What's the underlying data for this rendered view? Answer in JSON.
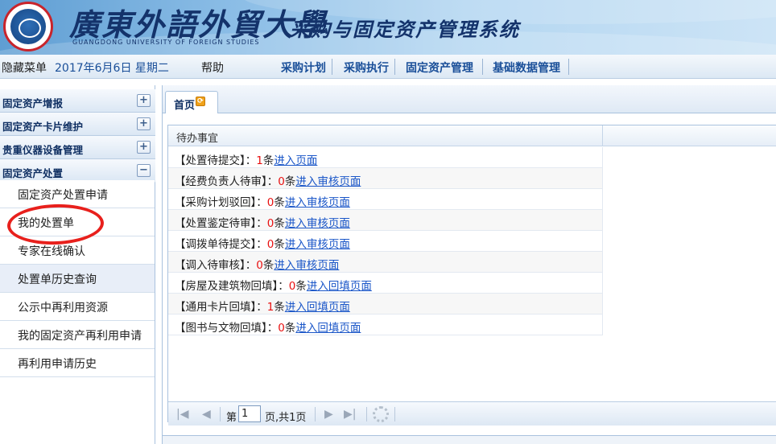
{
  "header": {
    "school_name": "廣東外語外貿大學",
    "school_name_en": "GUANGDONG UNIVERSITY OF FOREIGN STUDIES",
    "system_name": "采购与固定资产管理系统"
  },
  "menubar": {
    "hide_menu": "隐藏菜单",
    "date": "2017年6月6日 星期二",
    "help": "帮助",
    "nav": [
      "采购计划",
      "采购执行",
      "固定资产管理",
      "基础数据管理"
    ]
  },
  "sidebar": {
    "sections": [
      {
        "label": "固定资产增报",
        "toggle": "+"
      },
      {
        "label": "固定资产卡片维护",
        "toggle": "+"
      },
      {
        "label": "贵重仪器设备管理",
        "toggle": "+"
      },
      {
        "label": "固定资产处置",
        "toggle": "−"
      }
    ],
    "items": [
      "固定资产处置申请",
      "我的处置单",
      "专家在线确认",
      "处置单历史查询",
      "公示中再利用资源",
      "我的固定资产再利用申请",
      "再利用申请历史"
    ]
  },
  "tabs": [
    {
      "label": "首页"
    }
  ],
  "grid": {
    "header": "待办事宜",
    "rows": [
      {
        "prefix": "【处置待提交】：",
        "count": "1",
        "unit": "条",
        "link": "进入页面"
      },
      {
        "prefix": "【经费负责人待审】：",
        "count": "0",
        "unit": "条",
        "link": "进入审核页面"
      },
      {
        "prefix": "【采购计划驳回】：",
        "count": "0",
        "unit": "条",
        "link": "进入审核页面"
      },
      {
        "prefix": "【处置鉴定待审】：",
        "count": "0",
        "unit": "条",
        "link": "进入审核页面"
      },
      {
        "prefix": "【调拨单待提交】：",
        "count": "0",
        "unit": "条",
        "link": "进入审核页面"
      },
      {
        "prefix": "【调入待审核】：",
        "count": "0",
        "unit": "条",
        "link": "进入审核页面"
      },
      {
        "prefix": "【房屋及建筑物回填】：",
        "count": "0",
        "unit": "条",
        "link": "进入回填页面"
      },
      {
        "prefix": "【通用卡片回填】：",
        "count": "1",
        "unit": "条",
        "link": "进入回填页面"
      },
      {
        "prefix": "【图书与文物回填】：",
        "count": "0",
        "unit": "条",
        "link": "进入回填页面"
      }
    ]
  },
  "pager": {
    "page_prefix": "第",
    "page_value": "1",
    "page_suffix": "页,共1页"
  },
  "colors": {
    "accent": "#1a4f99",
    "link": "#1a56c8",
    "count": "#e81010",
    "annotation": "#e8201c"
  }
}
